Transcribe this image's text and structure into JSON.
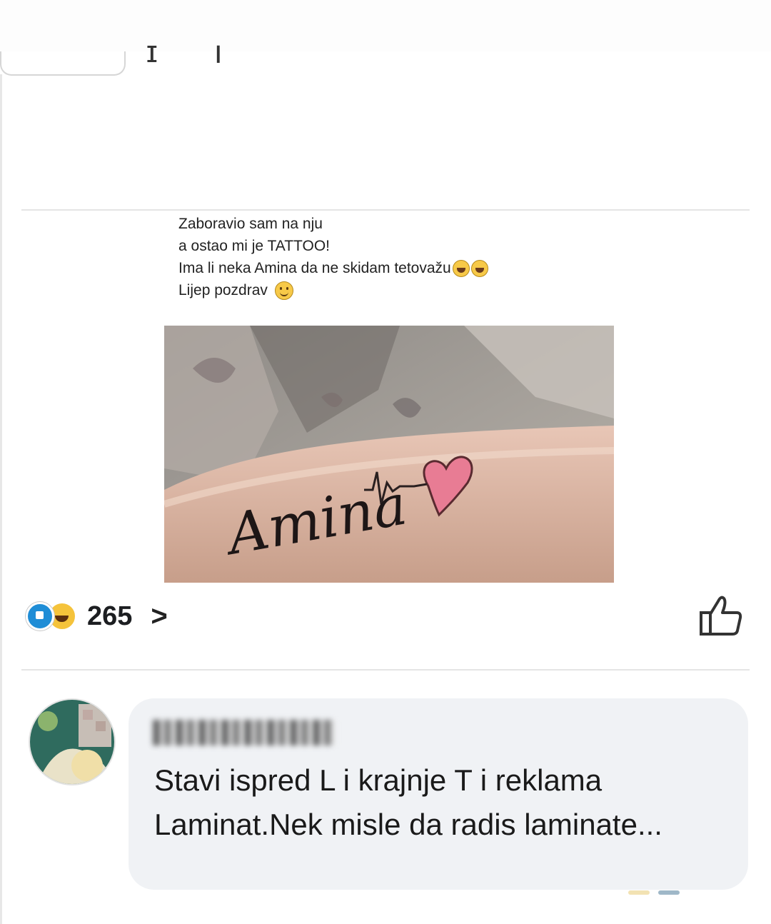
{
  "post": {
    "lines": [
      "Zaboravio sam na nju",
      "a ostao mi je TATTOO!",
      "Ima li neka Amina da ne skidam tetovažu",
      "Lijep pozdrav"
    ],
    "image": {
      "tattoo_text": "Amina"
    },
    "reactions": {
      "count": "265"
    }
  },
  "comment": {
    "author": "",
    "text": "Stavi ispred L i krajnje T i reklama Laminat.Nek misle da radis laminate..."
  },
  "colors": {
    "like_blue": "#1f8dd6",
    "haha_yellow": "#f5c33b",
    "bubble_bg": "#f0f2f5",
    "heart_pink": "#e87c94"
  },
  "icons": {
    "like_reaction": "like-reaction-icon",
    "haha_reaction": "haha-reaction-icon",
    "chevron": "chevron-right-icon",
    "like_button": "thumbs-up-icon",
    "laugh_emoji": "laughing-face-icon",
    "smile_emoji": "smiling-face-icon"
  }
}
